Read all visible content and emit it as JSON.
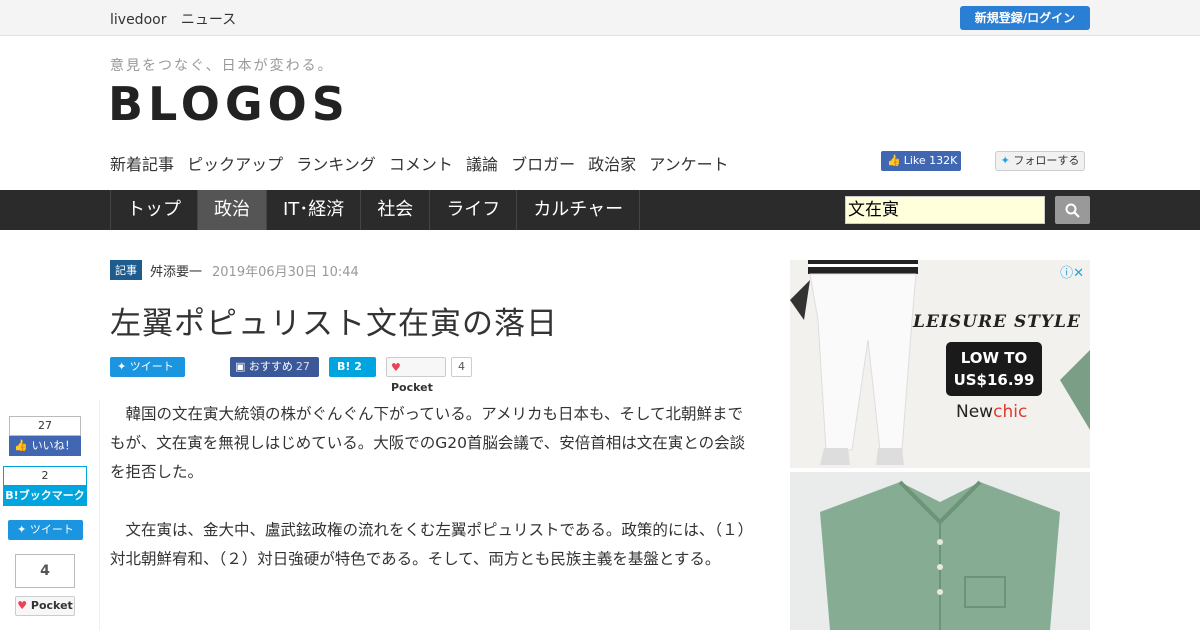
{
  "topbar": {
    "brand": "livedoor",
    "brand_section": "ニュース",
    "login_label": "新規登録/ログイン"
  },
  "header": {
    "tagline": "意見をつなぐ、日本が変わる。",
    "logo": "BLOGOS",
    "subnav": [
      "新着記事",
      "ピックアップ",
      "ランキング",
      "コメント",
      "議論",
      "ブロガー",
      "政治家",
      "アンケート"
    ],
    "fb_like_label": "Like",
    "fb_like_count": "132K",
    "twitter_follow_label": "フォローする"
  },
  "mainnav": {
    "tabs": [
      "トップ",
      "政治",
      "IT･経済",
      "社会",
      "ライフ",
      "カルチャー"
    ],
    "active_tab": "政治",
    "search_value": "文在寅"
  },
  "article": {
    "badge": "記事",
    "author": "舛添要一",
    "date": "2019年06月30日 10:44",
    "title": "左翼ポピュリスト文在寅の落日",
    "paragraphs": [
      "韓国の文在寅大統領の株がぐんぐん下がっている。アメリカも日本も、そして北朝鮮までもが、文在寅を無視しはじめている。大阪でのG20首脳会議で、安倍首相は文在寅との会談を拒否した。",
      "文在寅は、金大中、盧武鉉政権の流れをくむ左翼ポピュリストである。政策的には、（１）対北朝鮮宥和、（２）対日強硬が特色である。そして、両方とも民族主義を基盤とする。"
    ]
  },
  "share_bar": {
    "tweet_label": "ツイート",
    "fb_recommend_label": "おすすめ",
    "fb_recommend_count": "27",
    "hatena_label": "B!",
    "hatena_count": "2",
    "pocket_label": "Pocket",
    "pocket_count": "4"
  },
  "side_share": {
    "like_count": "27",
    "like_label": "いいね！",
    "hatena_count": "2",
    "hatena_label": "B!ブックマーク",
    "tweet_label": "ツイート",
    "pocket_count": "4",
    "pocket_label": "Pocket"
  },
  "ad": {
    "headline": "LEISURE STYLE",
    "price_line1": "LOW TO",
    "price_line2": "US$16.99",
    "brand_prefix": "New",
    "brand_suffix": "chic"
  },
  "colors": {
    "nav_bg": "#2b2b2b",
    "nav_active": "#555555",
    "login_blue": "#2a7fd4",
    "badge_blue": "#1f5c8e",
    "twitter": "#1b95e0",
    "facebook": "#3b5998",
    "hatena": "#00a4de",
    "pocket": "#ee4056"
  }
}
